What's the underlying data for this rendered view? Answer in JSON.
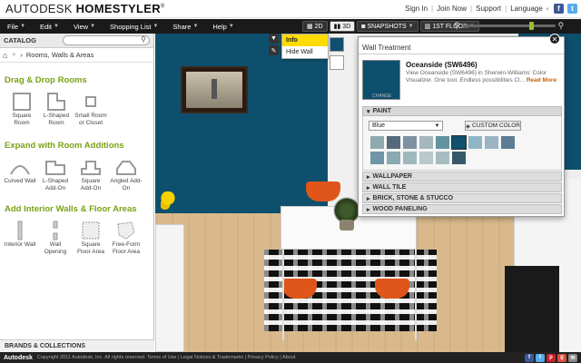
{
  "brand": {
    "autodesk": "AUTODESK",
    "homestyler": "HOMESTYLER",
    "tm": "®"
  },
  "top_links": {
    "sign_in": "Sign In",
    "join_now": "Join Now",
    "support": "Support",
    "language": "Language"
  },
  "menu": {
    "file": "File",
    "edit": "Edit",
    "view": "View",
    "shopping_list": "Shopping List",
    "share": "Share",
    "help": "Help",
    "view_2d": "2D",
    "view_3d": "3D",
    "snapshots": "SNAPSHOTS",
    "floor": "1ST FLOOR",
    "zoom_level": 0.76
  },
  "catalog": {
    "title": "CATALOG",
    "search_placeholder": "",
    "breadcrumb": "Rooms, Walls & Areas",
    "sections": [
      {
        "title": "Drag & Drop Rooms",
        "items": [
          "Square Room",
          "L-Shaped Room",
          "Small Room or Closet"
        ]
      },
      {
        "title": "Expand with Room Additions",
        "items": [
          "Curved Wall",
          "L-Shaped Add-On",
          "Square Add-On",
          "Angled Add-On"
        ]
      },
      {
        "title": "Add Interior Walls & Floor Areas",
        "items": [
          "Interior Wall",
          "Wall Opening",
          "Square Floor Area",
          "Free-Form Floor Area"
        ]
      }
    ],
    "footer": "BRANDS & COLLECTIONS"
  },
  "context_menu": {
    "info": "Info",
    "hide_wall": "Hide Wall"
  },
  "wall_treatment": {
    "title": "Wall Treatment",
    "color_name": "Oceanside (SW6496)",
    "description": "View Oceanside (SW6496) in Sherwin-Williams' Color Visualizer. One tool. Endless possibilities Cl...",
    "read_more": "Read More",
    "change": "CHANGE",
    "paint_label": "PAINT",
    "paint_filter": "Blue",
    "custom_color": "CUSTOM COLOR",
    "swatches": [
      "#8eaab0",
      "#56697a",
      "#7d91a0",
      "#a4b7bc",
      "#5f93a0",
      "#104f6e",
      "#8fb6c6",
      "#9cb3c4",
      "#5b7d95",
      "#6f96a6",
      "#8aa9b0",
      "#9eb9bd",
      "#b8c8cc",
      "#a7bcc0",
      "#38586a"
    ],
    "accordions": [
      "WALLPAPER",
      "WALL TILE",
      "BRICK, STONE & STUCCO",
      "WOOD PANELING"
    ]
  },
  "colors": {
    "wall_blue": "#0e4f6e",
    "accent_green": "#7aa116",
    "highlight": "#ffdc00"
  },
  "footer": {
    "logo": "Autodesk",
    "text": "Copyright 2011 Autodesk, Inc. All rights reserved. Terms of Use | Legal Notices & Trademarks | Privacy Policy | About"
  }
}
